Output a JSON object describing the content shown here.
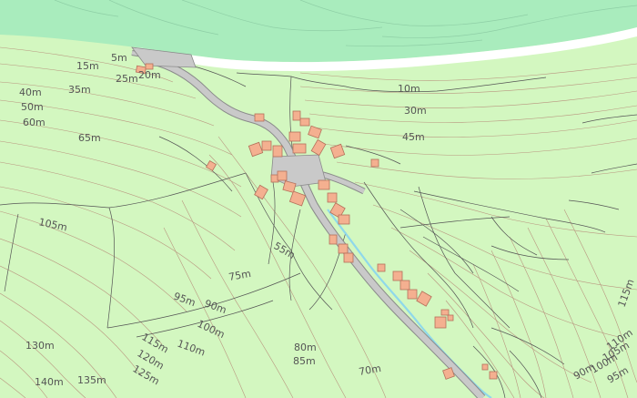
{
  "map": {
    "colors": {
      "land": "#d3f7c0",
      "sea": "#a9ecbd",
      "beach": "#ffffff",
      "contour": "#b9957f",
      "building": "#f4b090",
      "building_stroke": "#b5705a",
      "road": "#c9c9c9",
      "road_stroke": "#8a8a8a",
      "stream": "#8fd8ea",
      "field_line": "#555555"
    },
    "contour_labels": [
      {
        "text": "5m",
        "rot": 0
      },
      {
        "text": "15m",
        "rot": 0
      },
      {
        "text": "25m",
        "rot": 0
      },
      {
        "text": "20m",
        "rot": 0
      },
      {
        "text": "40m",
        "rot": 0
      },
      {
        "text": "35m",
        "rot": 0
      },
      {
        "text": "50m",
        "rot": 0
      },
      {
        "text": "60m",
        "rot": 0
      },
      {
        "text": "65m",
        "rot": 0
      },
      {
        "text": "10m",
        "rot": 0
      },
      {
        "text": "30m",
        "rot": 0
      },
      {
        "text": "45m",
        "rot": 0
      },
      {
        "text": "105m",
        "rot": 12
      },
      {
        "text": "55m",
        "rot": 30
      },
      {
        "text": "75m",
        "rot": -10
      },
      {
        "text": "95m",
        "rot": 20
      },
      {
        "text": "90m",
        "rot": 20
      },
      {
        "text": "100m",
        "rot": 25
      },
      {
        "text": "115m",
        "rot": 30
      },
      {
        "text": "110m",
        "rot": 20
      },
      {
        "text": "120m",
        "rot": 30
      },
      {
        "text": "125m",
        "rot": 30
      },
      {
        "text": "130m",
        "rot": 0
      },
      {
        "text": "80m",
        "rot": 0
      },
      {
        "text": "85m",
        "rot": 0
      },
      {
        "text": "70m",
        "rot": -10
      },
      {
        "text": "140m",
        "rot": 0
      },
      {
        "text": "135m",
        "rot": 0
      },
      {
        "text": "115m",
        "rot": -70
      },
      {
        "text": "110m",
        "rot": -35
      },
      {
        "text": "105m",
        "rot": -30
      },
      {
        "text": "100m",
        "rot": -30
      },
      {
        "text": "90m",
        "rot": -30
      },
      {
        "text": "95m",
        "rot": -30
      }
    ]
  }
}
